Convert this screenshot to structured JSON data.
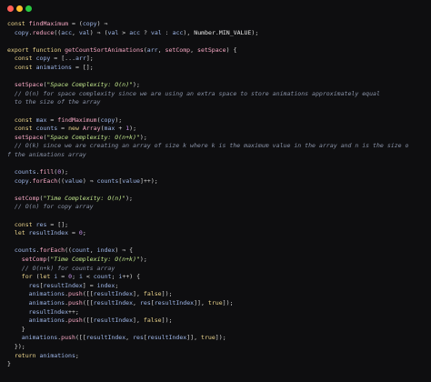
{
  "window": {
    "buttons": [
      "close",
      "minimize",
      "maximize"
    ],
    "colors": {
      "close": "#ff5f57",
      "minimize": "#febc2e",
      "maximize": "#28c840",
      "background": "#0e0e10"
    }
  },
  "code": {
    "lines": [
      "const findMaximum = (copy) ⇒",
      "  copy.reduce((acc, val) ⇒ (val > acc ? val : acc), Number.MIN_VALUE);",
      "",
      "export function getCountSortAnimations(arr, setComp, setSpace) {",
      "  const copy = [...arr];",
      "  const animations = [];",
      "",
      "  setSpace(\"Space Complexity: O(n)\");",
      "  // O(n) for space complexity since we are using an extra space to store animations approximately equal",
      "  to the size of the array",
      "",
      "  const max = findMaximum(copy);",
      "  const counts = new Array(max + 1);",
      "  setSpace(\"Space Complexity: O(n+k)\");",
      "  // O(k) since we are creating an array of size k where k is the maximum value in the array and n is the size of the animations array",
      "",
      "  counts.fill(0);",
      "  copy.forEach((value) ⇒ counts[value]++);",
      "",
      "  setComp(\"Time Complexity: O(n)\");",
      "  // O(n) for copy array",
      "",
      "  const res = [];",
      "  let resultIndex = 0;",
      "",
      "  counts.forEach((count, index) ⇒ {",
      "    setComp(\"Time Complexity: O(n+k)\");",
      "    // O(n+k) for counts array",
      "    for (let i = 0; i < count; i++) {",
      "      res[resultIndex] = index;",
      "      animations.push([[resultIndex], false]);",
      "      animations.push([[resultIndex, res[resultIndex]], true]);",
      "      resultIndex++;",
      "      animations.push([[resultIndex], false]);",
      "    }",
      "    animations.push([[resultIndex, res[resultIndex]], true]);",
      "  });",
      "  return animations;",
      "}"
    ]
  }
}
